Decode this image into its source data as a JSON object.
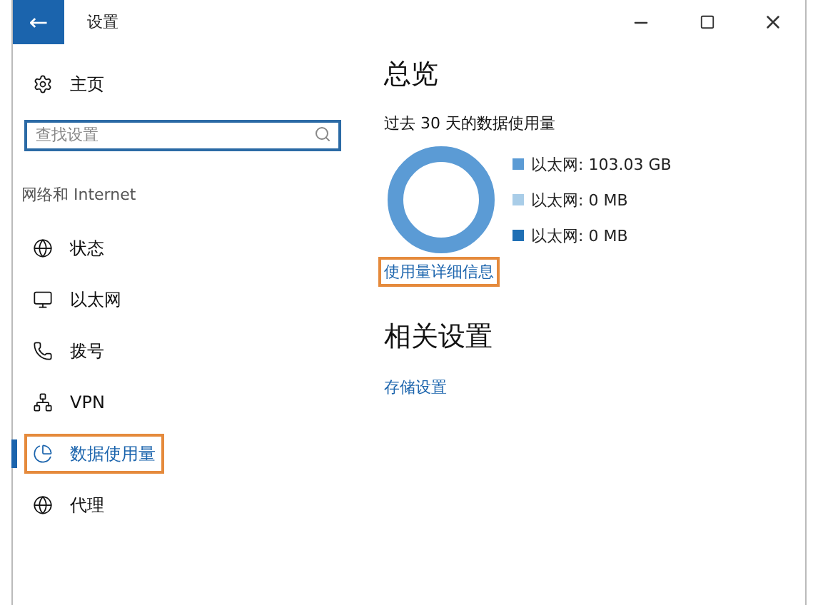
{
  "window": {
    "title": "设置",
    "back_button": "←"
  },
  "sidebar": {
    "home": "主页",
    "search": {
      "placeholder": "查找设置"
    },
    "section": "网络和 Internet",
    "items": [
      {
        "label": "状态",
        "kind": "status",
        "selected": false
      },
      {
        "label": "以太网",
        "kind": "ethernet",
        "selected": false
      },
      {
        "label": "拨号",
        "kind": "dialup",
        "selected": false
      },
      {
        "label": "VPN",
        "kind": "vpn",
        "selected": false
      },
      {
        "label": "数据使用量",
        "kind": "data",
        "selected": true
      },
      {
        "label": "代理",
        "kind": "proxy",
        "selected": false
      }
    ]
  },
  "main": {
    "title": "总览",
    "subtitle": "过去 30 天的数据使用量",
    "legend": [
      {
        "label": "以太网: 103.03 GB",
        "color": "#5b9bd5"
      },
      {
        "label": "以太网: 0 MB",
        "color": "#a9cde8"
      },
      {
        "label": "以太网: 0 MB",
        "color": "#1f6fb4"
      }
    ],
    "details_link": {
      "label": "使用量详细信息",
      "highlighted": true
    },
    "related_title": "相关设置",
    "related_links": [
      "存储设置"
    ]
  }
}
